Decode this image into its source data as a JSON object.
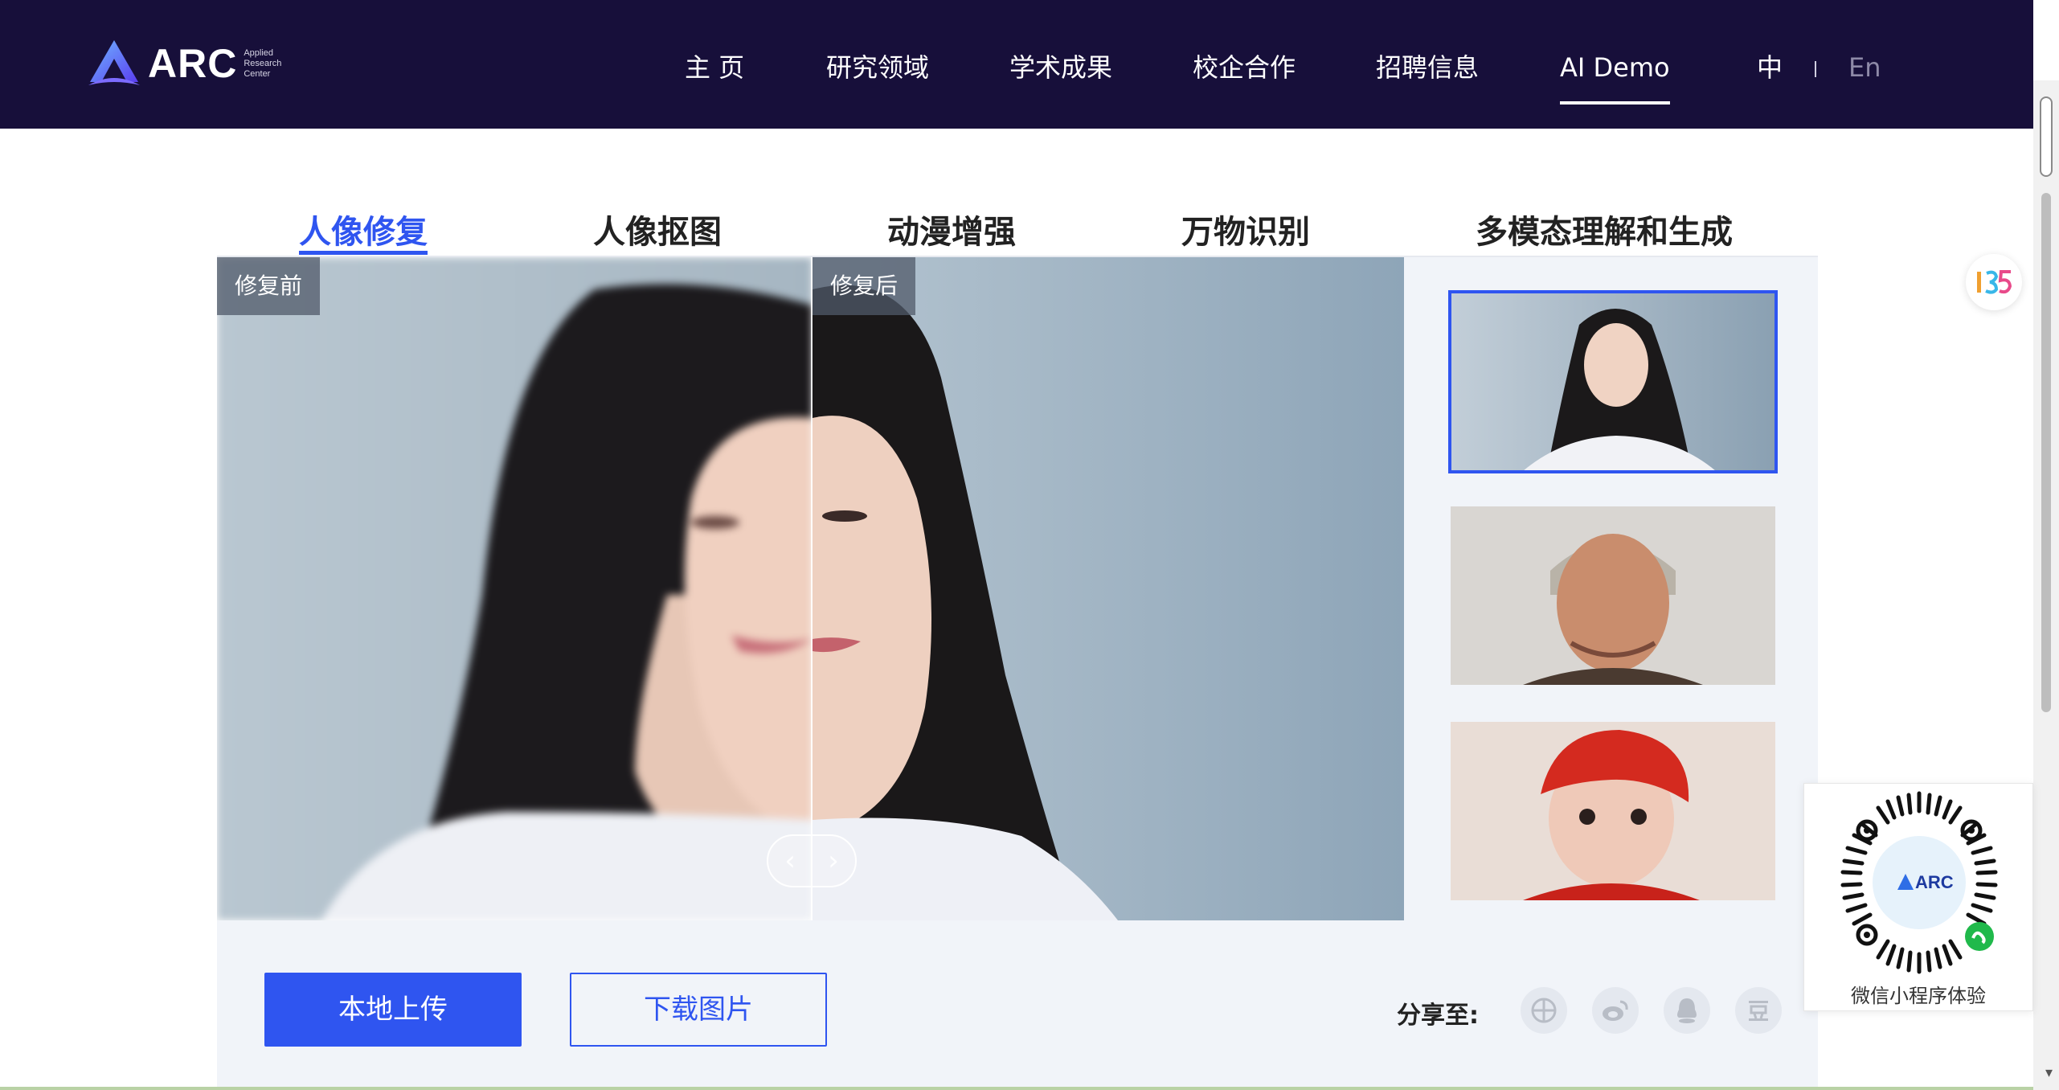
{
  "header": {
    "logo_text": "ARC",
    "logo_sub": [
      "Applied",
      "Research",
      "Center"
    ],
    "nav": [
      {
        "label": "主 页",
        "active": false
      },
      {
        "label": "研究领域",
        "active": false
      },
      {
        "label": "学术成果",
        "active": false
      },
      {
        "label": "校企合作",
        "active": false
      },
      {
        "label": "招聘信息",
        "active": false
      },
      {
        "label": "AI Demo",
        "active": true
      }
    ],
    "lang_zh": "中",
    "lang_en": "En"
  },
  "tabs": [
    {
      "label": "人像修复",
      "active": true
    },
    {
      "label": "人像抠图",
      "active": false
    },
    {
      "label": "动漫增强",
      "active": false
    },
    {
      "label": "万物识别",
      "active": false
    },
    {
      "label": "多模态理解和生成",
      "active": false
    }
  ],
  "compare": {
    "before_label": "修复前",
    "after_label": "修复后",
    "handle_left": "‹",
    "handle_right": "›"
  },
  "samples": [
    {
      "name": "young-woman",
      "selected": true
    },
    {
      "name": "older-man",
      "selected": false
    },
    {
      "name": "child-red-hat",
      "selected": false
    }
  ],
  "actions": {
    "upload": "本地上传",
    "download": "下载图片"
  },
  "share": {
    "label": "分享至:",
    "icons": [
      "wechat-moments-icon",
      "weibo-icon",
      "qq-icon",
      "douban-icon"
    ]
  },
  "float": {
    "badge_icon": "135-editor-icon",
    "qr_label": "微信小程序体验",
    "qr_logo_text": "ARC"
  },
  "colors": {
    "header_bg": "#170f3a",
    "accent": "#2f55f0",
    "panel_bg": "#f1f4f9"
  }
}
